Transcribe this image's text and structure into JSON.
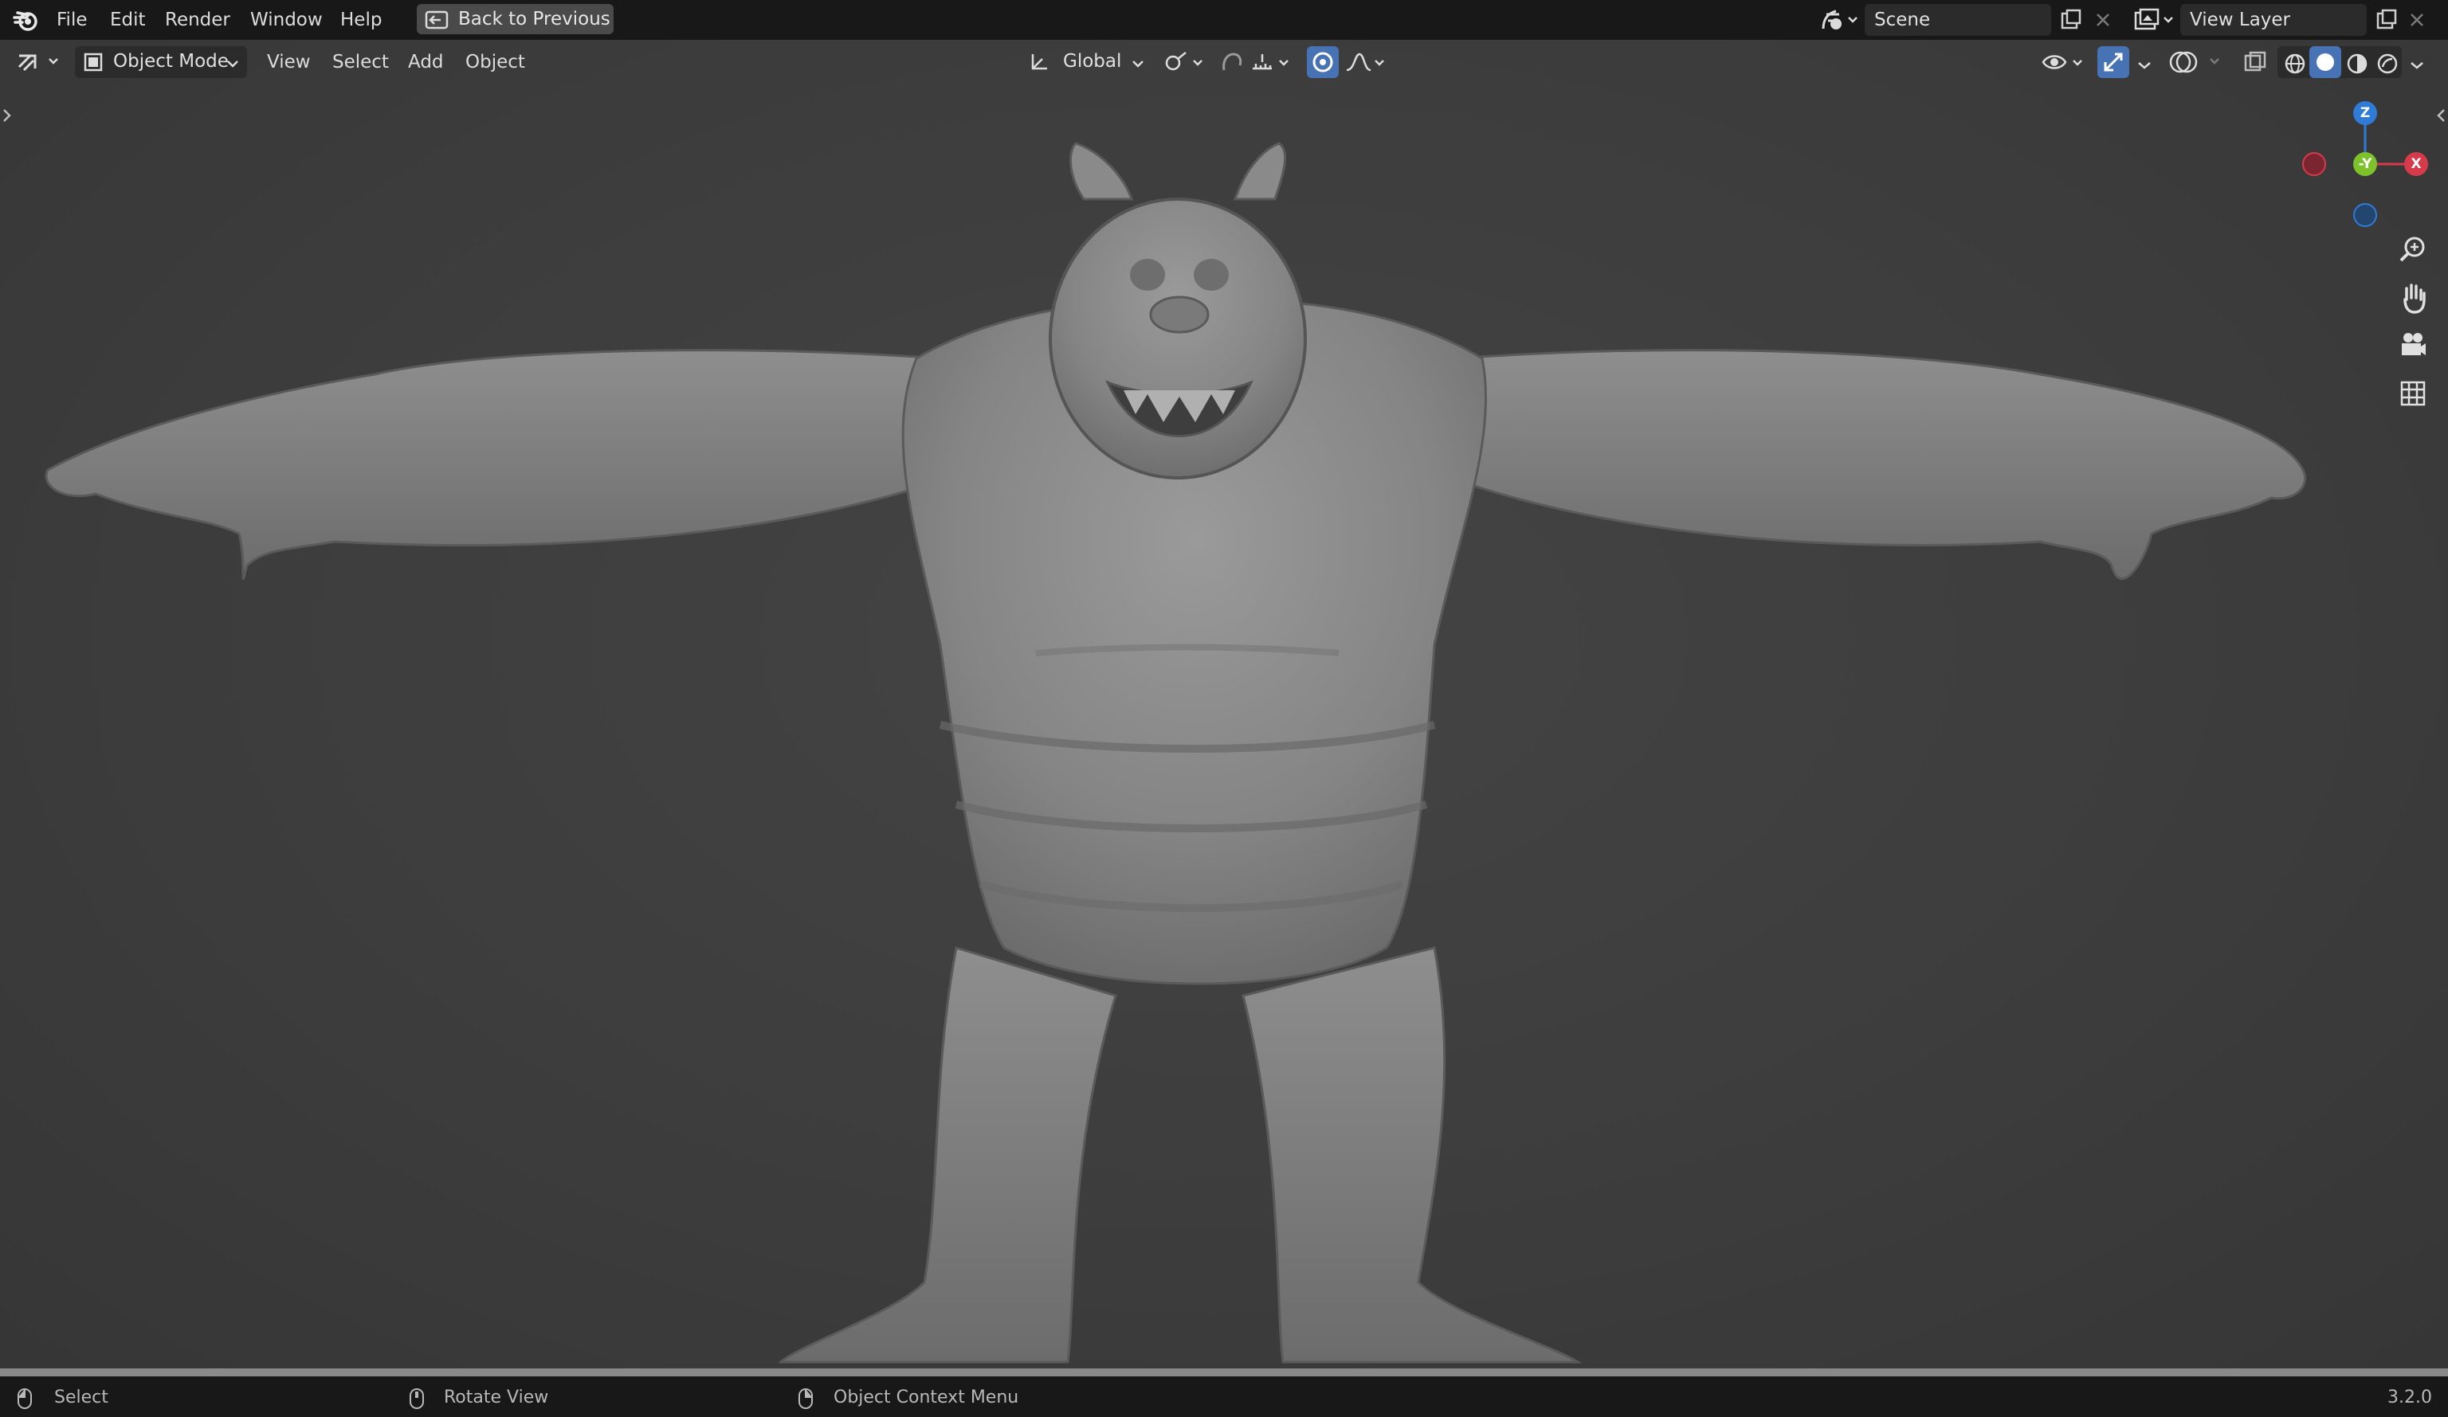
{
  "topbar": {
    "menus": [
      "File",
      "Edit",
      "Render",
      "Window",
      "Help"
    ],
    "back_button": "Back to Previous",
    "scene": "Scene",
    "view_layer": "View Layer"
  },
  "viewport_header": {
    "mode": "Object Mode",
    "menus": [
      "View",
      "Select",
      "Add",
      "Object"
    ],
    "transform_orientation": "Global"
  },
  "gizmo": {
    "z_label": "Z",
    "y_label": "-Y",
    "x_label": "X"
  },
  "statusbar": {
    "select": "Select",
    "rotate": "Rotate View",
    "context": "Object Context Menu",
    "version": "3.2.0"
  },
  "colors": {
    "x_axis": "#d63a4b",
    "y_axis": "#7dc22b",
    "z_axis": "#2f7bd6",
    "accent": "#4772b3"
  }
}
